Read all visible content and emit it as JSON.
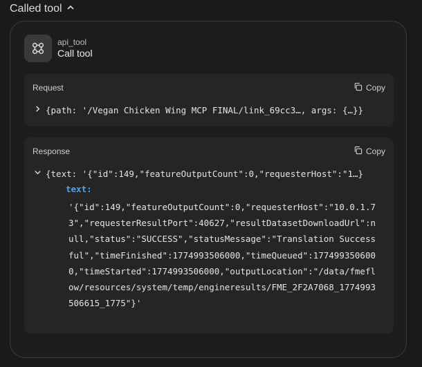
{
  "header": {
    "title": "Called tool"
  },
  "tool": {
    "name": "api_tool",
    "action": "Call tool"
  },
  "request": {
    "label": "Request",
    "copy_label": "Copy",
    "summary": "{path: '/Vegan Chicken Wing MCP FINAL/link_69cc3…, args: {…}}"
  },
  "response": {
    "label": "Response",
    "copy_label": "Copy",
    "summary": "{text: '{\"id\":149,\"featureOutputCount\":0,\"requesterHost\":\"1…}",
    "key": "text:",
    "value_lines": [
      "'{\"id\":149,\"featureOutputCount\":0,\"requesterHost\":\"10.0.1.7",
      "3\",\"requesterResultPort\":40627,\"resultDatasetDownloadUrl\":n",
      "ull,\"status\":\"SUCCESS\",\"statusMessage\":\"Translation Success",
      "ful\",\"timeFinished\":1774993506000,\"timeQueued\":177499350600",
      "0,\"timeStarted\":1774993506000,\"outputLocation\":\"/data/fmefl",
      "ow/resources/system/temp/engineresults/FME_2F2A7068_1774993",
      "506615_1775\"}'"
    ]
  },
  "icons": {
    "header": "chevron-up-icon",
    "tool": "command-icon",
    "copy": "copy-icon",
    "request_toggle": "chevron-right-icon",
    "response_toggle": "chevron-down-icon"
  },
  "colors": {
    "background": "#1a1a1a",
    "card": "#1d1d1d",
    "panel": "#252525",
    "key": "#4ea2f2"
  }
}
